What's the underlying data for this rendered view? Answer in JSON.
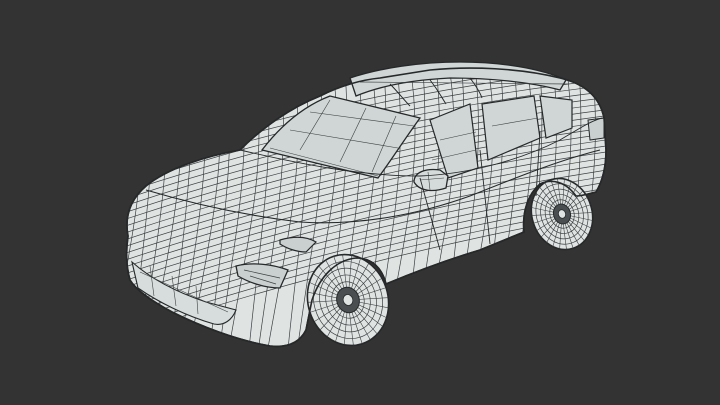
{
  "viewport": {
    "background": "#333333"
  },
  "model": {
    "subject": "car-wireframe",
    "colors": {
      "body_fill": "#dfe4e3",
      "glass_fill": "#cfd6d5",
      "wire": "#3c3f40",
      "outline": "#262829",
      "dark_part": "#4a4e50"
    }
  }
}
